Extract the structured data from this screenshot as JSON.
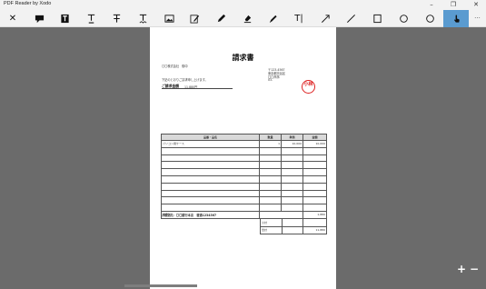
{
  "window": {
    "title": "PDF Reader by Xodo",
    "minimize_glyph": "–",
    "maximize_glyph": "❐",
    "close_glyph": "✕"
  },
  "toolbar": {
    "active_tool": "touch-pan",
    "tools": [
      {
        "name": "close-tool",
        "icon": "x-icon",
        "glyph": "✕"
      },
      {
        "name": "comment-tool",
        "icon": "sticky-note-icon"
      },
      {
        "name": "text-box-tool",
        "icon": "text-box-icon"
      },
      {
        "name": "underline-tool",
        "icon": "underline-icon",
        "glyph": "T"
      },
      {
        "name": "strikeout-tool",
        "icon": "strikeout-icon",
        "glyph": "T"
      },
      {
        "name": "squiggly-tool",
        "icon": "squiggly-icon",
        "glyph": "T"
      },
      {
        "name": "image-tool",
        "icon": "image-icon"
      },
      {
        "name": "signature-tool",
        "icon": "signature-icon"
      },
      {
        "name": "ink-tool",
        "icon": "pen-icon"
      },
      {
        "name": "eraser-tool",
        "icon": "eraser-icon"
      },
      {
        "name": "highlighter-tool",
        "icon": "highlighter-icon"
      },
      {
        "name": "free-text-tool",
        "icon": "free-text-icon",
        "glyph": "T|"
      },
      {
        "name": "arrow-tool",
        "icon": "arrow-icon"
      },
      {
        "name": "line-tool",
        "icon": "line-icon"
      },
      {
        "name": "rectangle-tool",
        "icon": "rectangle-icon"
      },
      {
        "name": "oval-tool",
        "icon": "circle-icon"
      },
      {
        "name": "polygon-tool",
        "icon": "polygon-icon"
      },
      {
        "name": "touch-pan-tool",
        "icon": "touch-hand-icon"
      },
      {
        "name": "more-tool",
        "icon": "more-icon",
        "glyph": "···"
      }
    ]
  },
  "document": {
    "title": "請求書",
    "recipient": "〇〇株式会社　御中",
    "intro": "下記のとおりご請求申し上げます。",
    "amount_label": "ご請求金額",
    "amount_value": "11,880円",
    "sender_lines": [
      "〒123-4567",
      "東京都渋谷区",
      "〇〇商事",
      "03-"
    ],
    "seal_text": "小林",
    "table_headers": [
      "品番・品名",
      "数量",
      "単価",
      "金額"
    ],
    "items": [
      [
        "パソコン用ケース",
        "1",
        "10,000",
        "10,000"
      ],
      [
        "",
        "",
        "",
        ""
      ],
      [
        "",
        "",
        "",
        ""
      ],
      [
        "",
        "",
        "",
        ""
      ],
      [
        "",
        "",
        "",
        ""
      ],
      [
        "",
        "",
        "",
        ""
      ],
      [
        "",
        "",
        "",
        ""
      ],
      [
        "",
        "",
        "",
        ""
      ],
      [
        "",
        "",
        "",
        ""
      ],
      [
        "",
        "",
        "",
        ""
      ]
    ],
    "shipping_label": "消費税",
    "shipping_value": "1,880",
    "subtotal_label": "小計",
    "subtotal_value": "",
    "total_label": "合計",
    "total_value": "11,880",
    "bank_note": "お振込先：〇〇銀行本店　普通1234567"
  },
  "zoom": {
    "plus_glyph": "+",
    "minus_glyph": "−"
  },
  "colors": {
    "active_tool_bg": "#5a9bd0",
    "canvas_bg": "#6b6b6b",
    "seal_red": "#dd2222"
  }
}
